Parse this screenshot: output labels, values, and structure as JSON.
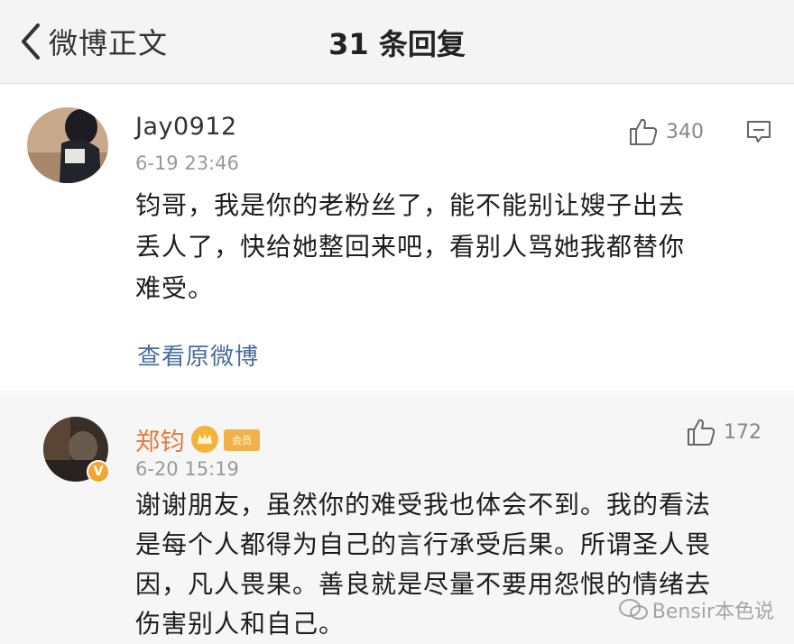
{
  "header": {
    "back_label": "微博正文",
    "title": "31 条回复"
  },
  "comment": {
    "username": "Jay0912",
    "timestamp": "6-19 23:46",
    "likes": "340",
    "text_lines": [
      "钧哥，我是你的老粉丝了，能不能别让嫂子出去",
      "丢人了，快给她整回来吧，看别人骂她我都替你",
      "难受。"
    ],
    "view_original": "查看原微博"
  },
  "reply": {
    "username": "郑钧",
    "timestamp": "6-20 15:19",
    "likes": "172",
    "badge_text": "会员",
    "verified_mark": "V",
    "text_lines": [
      "谢谢朋友，虽然你的难受我也体会不到。我的看法",
      "是每个人都得为自己的言行承受后果。所谓圣人畏",
      "因，凡人畏果。善良就是尽量不要用怨恨的情绪去",
      "伤害别人和自己。"
    ]
  },
  "watermark": "Bensir本色说",
  "colors": {
    "link": "#4a6d9c",
    "timestamp": "#9a9a9a",
    "vip_orange": "#f3b43c",
    "reply_name": "#e07b3c"
  }
}
